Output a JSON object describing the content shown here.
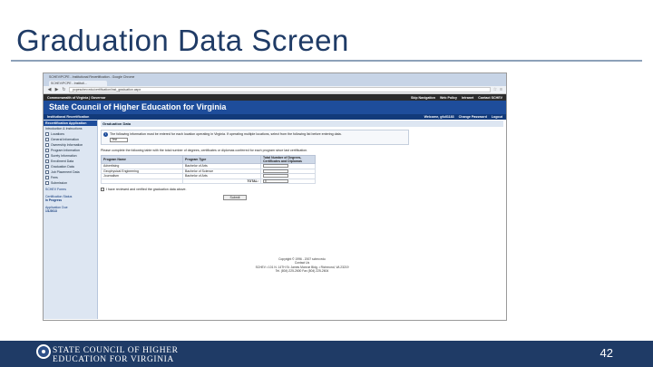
{
  "slide": {
    "title": "Graduation Data Screen",
    "page_number": "42",
    "org_line1": "STATE COUNCIL OF HIGHER",
    "org_line2": "EDUCATION FOR VIRGINIA"
  },
  "browser": {
    "tab_label": "SCHEV/PCPE - Instituti...",
    "window_title": "SCHEV/PCPE - Institutional Recertification - Google Chrome",
    "url": "pcpeschev.edu/certification/inst_graduation.aspx"
  },
  "topbar": {
    "left": "Commonwealth of Virginia  |  Governor",
    "links": [
      "Skip Navigation",
      "Web Policy",
      "Intranet",
      "Contact SCHEV"
    ]
  },
  "banner": {
    "title": "State Council of Higher Education for Virginia"
  },
  "subbar": {
    "left": "Institutional Recertification",
    "welcome": "Welcome, gfull1183",
    "change_password": "Change Password",
    "logout": "Logout"
  },
  "sidebar": {
    "head": "Recertification Application",
    "intro": "Introduction & Instructions",
    "items": [
      "Locations",
      "General Information",
      "Ownership Information",
      "Program Information",
      "Surety Information",
      "Enrollment Data",
      "Graduation Data",
      "Job Placement Data",
      "Fees",
      "Submission"
    ],
    "forms_link": "SCHEV Forms",
    "status_label": "Certification Status",
    "status_value": "In Progress",
    "due_label": "Application Due",
    "due_value": "1/1/2013"
  },
  "main": {
    "header": "Graduation Data",
    "notice": "The following information must be entered for each location operating in Virginia. If operating multiple locations, select from the following list before entering data.",
    "location_select": "Test",
    "instructions": "Please complete the following table with the total number of degrees, certificates or diplomas conferred for each program since last certification.",
    "table": {
      "headers": [
        "Program Name",
        "Program Type",
        "Total Number of Degrees, Certificates and Diplomas"
      ],
      "rows": [
        {
          "name": "Advertising",
          "type": "Bachelor of Arts"
        },
        {
          "name": "Geophysical Engineering",
          "type": "Bachelor of Science"
        },
        {
          "name": "Journalism",
          "type": "Bachelor of Arts"
        }
      ],
      "total_label": "TOTAL:",
      "total_value": "0"
    },
    "confirm_label": "I have reviewed and verified the graduation data above.",
    "submit_label": "Submit",
    "footer_line1": "Copyright © 1996 - 2007 schev.edu",
    "footer_line2": "Contact Us",
    "footer_line3": "SCHEV • 101 N. 14TH St. James Monroe Bldg. • Richmond, VA 23219",
    "footer_line4": "Tel. (804) 225-2600  Fax (804) 225-2604"
  }
}
